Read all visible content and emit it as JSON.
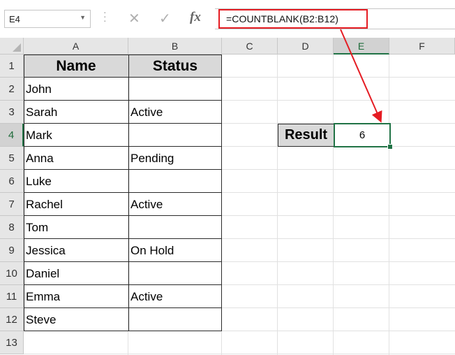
{
  "name_box": {
    "value": "E4",
    "dropdown_icon": "chevron-down-icon"
  },
  "formula_bar": {
    "cancel_icon": "x-icon",
    "enter_icon": "check-icon",
    "fx_label": "fx",
    "formula": "=COUNTBLANK(B2:B12)"
  },
  "columns": [
    "A",
    "B",
    "C",
    "D",
    "E",
    "F"
  ],
  "active_column": "E",
  "rows": [
    "1",
    "2",
    "3",
    "4",
    "5",
    "6",
    "7",
    "8",
    "9",
    "10",
    "11",
    "12",
    "13"
  ],
  "active_row": "4",
  "table": {
    "headers": {
      "name": "Name",
      "status": "Status"
    },
    "records": [
      {
        "name": "John",
        "status": ""
      },
      {
        "name": "Sarah",
        "status": "Active"
      },
      {
        "name": "Mark",
        "status": ""
      },
      {
        "name": "Anna",
        "status": "Pending"
      },
      {
        "name": "Luke",
        "status": ""
      },
      {
        "name": "Rachel",
        "status": "Active"
      },
      {
        "name": "Tom",
        "status": ""
      },
      {
        "name": "Jessica",
        "status": "On Hold"
      },
      {
        "name": "Daniel",
        "status": ""
      },
      {
        "name": "Emma",
        "status": "Active"
      },
      {
        "name": "Steve",
        "status": ""
      }
    ]
  },
  "result": {
    "label": "Result",
    "value": "6"
  },
  "colors": {
    "accent": "#217346",
    "highlight": "#e51c23",
    "header_fill": "#d9d9d9"
  }
}
